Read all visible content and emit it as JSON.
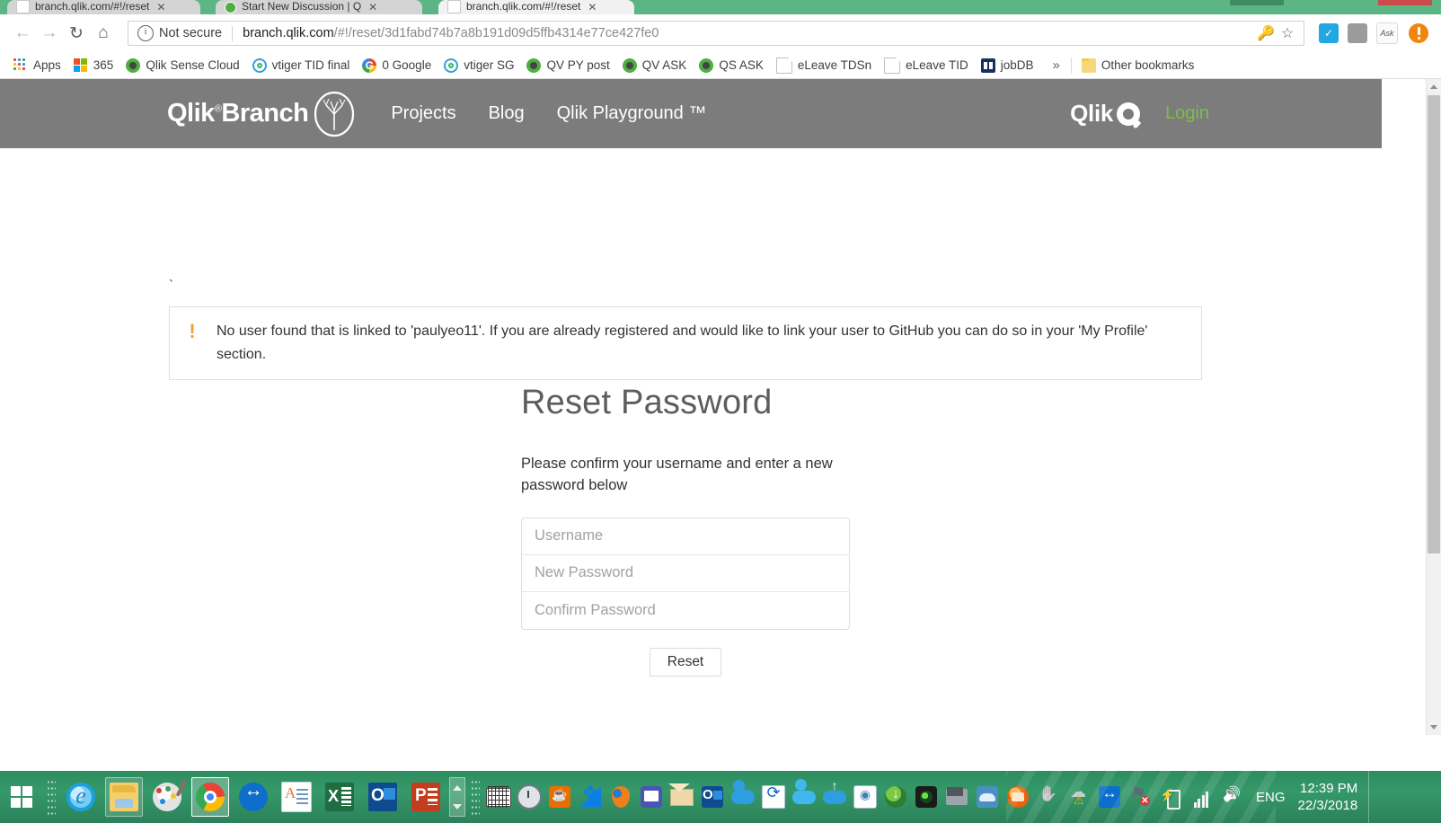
{
  "browser": {
    "tabs": [
      {
        "title": "branch.qlik.com/#!/reset",
        "favicon": "page-icon",
        "active": false
      },
      {
        "title": "Start New Discussion | Q",
        "favicon": "qlik-icon",
        "active": false
      },
      {
        "title": "branch.qlik.com/#!/reset",
        "favicon": "page-icon",
        "active": true
      }
    ],
    "nav": {
      "back": "←",
      "forward": "→",
      "reload": "↻",
      "home": "⌂"
    },
    "omnibox": {
      "security_label": "Not secure",
      "url_host": "branch.qlik.com",
      "url_path": "/#!/reset/3d1fabd74b7a8b191d09d5ffb4314e77ce427fe0",
      "save_password_icon": "key-icon",
      "bookmark_icon": "star-icon"
    },
    "extensions": [
      {
        "name": "checkmark-extension-icon",
        "glyph": "✓"
      },
      {
        "name": "ghost-extension-icon",
        "glyph": ""
      },
      {
        "name": "ask-extension-icon",
        "glyph": "Ask"
      }
    ],
    "profile": "profile-avatar",
    "bookmarks": [
      {
        "label": "Apps",
        "icon": "apps-grid-icon"
      },
      {
        "label": "365",
        "icon": "microsoft-icon"
      },
      {
        "label": "Qlik Sense Cloud",
        "icon": "qlik-icon"
      },
      {
        "label": "vtiger TID final",
        "icon": "vtiger-icon"
      },
      {
        "label": "0 Google",
        "icon": "google-icon"
      },
      {
        "label": "vtiger SG",
        "icon": "vtiger-icon"
      },
      {
        "label": "QV PY post",
        "icon": "qlik-icon"
      },
      {
        "label": "QV ASK",
        "icon": "qlik-icon"
      },
      {
        "label": "QS ASK",
        "icon": "qlik-icon"
      },
      {
        "label": "eLeave TDSn",
        "icon": "page-icon"
      },
      {
        "label": "eLeave TID",
        "icon": "page-icon"
      },
      {
        "label": "jobDB",
        "icon": "jobdb-icon"
      }
    ],
    "bookmarks_overflow": "»",
    "other_bookmarks": {
      "label": "Other bookmarks",
      "icon": "folder-icon"
    }
  },
  "page": {
    "header": {
      "brand": "Qlik",
      "brand_registered": "®",
      "brand_second": "Branch",
      "nav": [
        {
          "label": "Projects"
        },
        {
          "label": "Blog"
        },
        {
          "label": "Qlik Playground ™"
        }
      ],
      "qlik_logo_text": "Qlik",
      "login_label": "Login",
      "login_color": "#7ac143",
      "bar_color": "#7c7c7c"
    },
    "stray_mark": "`",
    "alert": {
      "icon": "exclamation-icon",
      "icon_color": "#f5a030",
      "message": "No user found that is linked to 'paulyeo11'. If you are already registered and would like to link your user to GitHub you can do so in your 'My Profile' section."
    },
    "reset_form": {
      "title": "Reset Password",
      "subtitle": "Please confirm your username and enter a new password below",
      "fields": [
        {
          "name": "username",
          "placeholder": "Username",
          "value": "",
          "type": "text"
        },
        {
          "name": "new-password",
          "placeholder": "New Password",
          "value": "",
          "type": "password"
        },
        {
          "name": "confirm-password",
          "placeholder": "Confirm Password",
          "value": "",
          "type": "password"
        }
      ],
      "submit_label": "Reset"
    }
  },
  "taskbar": {
    "start": "windows-logo",
    "pinned": [
      {
        "name": "internet-explorer",
        "state": "idle"
      },
      {
        "name": "file-explorer",
        "state": "running"
      },
      {
        "name": "paint",
        "state": "idle"
      },
      {
        "name": "google-chrome",
        "state": "active"
      },
      {
        "name": "teamviewer",
        "state": "idle"
      },
      {
        "name": "wordpad",
        "state": "idle"
      },
      {
        "name": "excel",
        "state": "idle"
      },
      {
        "name": "outlook",
        "state": "idle"
      },
      {
        "name": "powerpoint",
        "state": "idle"
      }
    ],
    "tray": [
      "on-screen-keyboard-icon",
      "clock-utility-icon",
      "java-icon",
      "dropbox-icon",
      "location-pin-icon",
      "monitor-icon",
      "mail-envelope-icon",
      "outlook-tray-icon",
      "onedrive-icon",
      "sync-icon",
      "cloud-icon",
      "cloud-upload-icon",
      "brain-icon",
      "download-manager-icon",
      "webcam-icon",
      "display-icon",
      "sky-drive-icon",
      "orange-app-icon",
      "hand-icon",
      "cloud-warning-icon",
      "teamviewer-tray-icon",
      "flag-action-center-icon",
      "battery-icon",
      "network-signal-icon",
      "volume-icon"
    ],
    "language": "ENG",
    "time": "12:39 PM",
    "date": "22/3/2018"
  }
}
